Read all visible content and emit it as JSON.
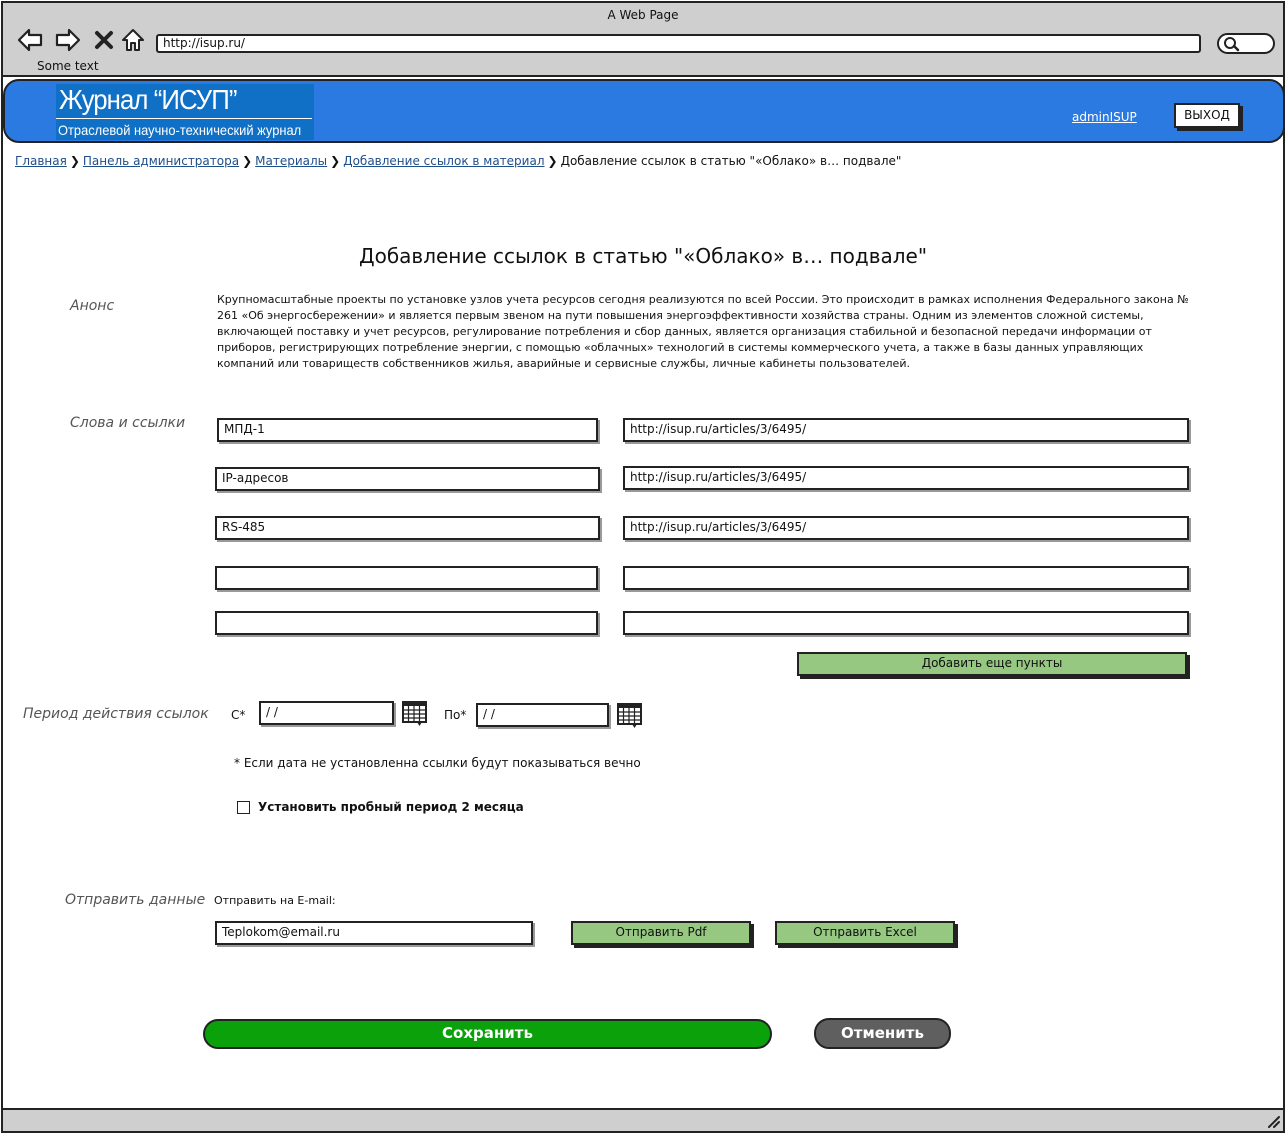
{
  "browser": {
    "window_title": "A Web Page",
    "url": "http://isup.ru/",
    "status_text": "Some text"
  },
  "header": {
    "logo_title": "Журнал “ИСУП”",
    "logo_subtitle": "Отраслевой научно-технический журнал",
    "user": "adminISUP",
    "logout_label": "ВЫХОД",
    "accent_color": "#2a7ae2"
  },
  "breadcrumb": {
    "items": [
      "Главная",
      "Панель администратора",
      "Материалы",
      "Добавление ссылок в материал"
    ],
    "current": "Добавление ссылок в статью \"«Облако» в… подвале\""
  },
  "page": {
    "title": "Добавление ссылок в статью \"«Облако» в… подвале\""
  },
  "announce": {
    "label": "Анонс",
    "text": "Крупномасштабные проекты по установке узлов учета ресурсов сегодня реализуются по всей России. Это происходит в рамках исполнения Федерального закона № 261 «Об энергосбережении» и является первым звеном на пути повышения энергоэффективности хозяйства страны. Одним из элементов сложной системы, включающей поставку и учет ресурсов, регулирование потребления и сбор данных, является организация стабильной и безопасной передачи информации от приборов, регистрирующих потребление энергии, с помощью «облачных» технологий в системы коммерческого учета, а также в базы данных управляющих компаний или товариществ собственников жилья, аварийные и сервисные службы, личные кабинеты пользователей."
  },
  "links": {
    "label": "Слова и ссылки",
    "rows": [
      {
        "word": "МПД-1",
        "url": "http://isup.ru/articles/3/6495/"
      },
      {
        "word": "IP-адресов",
        "url": "http://isup.ru/articles/3/6495/"
      },
      {
        "word": "RS-485",
        "url": "http://isup.ru/articles/3/6495/"
      },
      {
        "word": "",
        "url": ""
      },
      {
        "word": "",
        "url": ""
      }
    ],
    "add_more_label": "Добавить еще пункты"
  },
  "period": {
    "label": "Период действия ссылок",
    "from_label": "С*",
    "from_value": " /  /",
    "to_label": "По*",
    "to_value": " /  /",
    "note": "* Если дата не установленна ссылки будут показываться вечно",
    "trial_label": "Установить пробный период 2 месяца"
  },
  "send": {
    "label": "Отправить данные",
    "email_label": "Отправить на E-mail:",
    "email_value": "Teplokom@email.ru",
    "pdf_label": "Отправить Pdf",
    "excel_label": "Отправить Excel"
  },
  "actions": {
    "save_label": "Сохранить",
    "cancel_label": "Отменить"
  }
}
